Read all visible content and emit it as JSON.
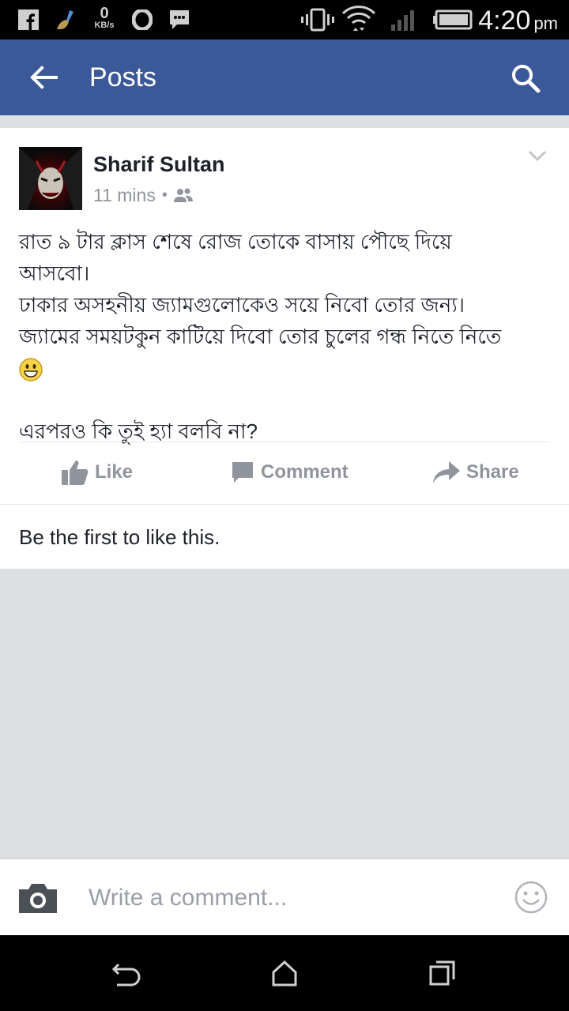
{
  "status_bar": {
    "net_speed_value": "0",
    "net_speed_unit": "KB/s",
    "time": "4:20",
    "ampm": "pm",
    "icons": [
      "facebook-icon",
      "broom-icon",
      "net-speed",
      "opera-icon",
      "messenger-icon",
      "vibrate-icon",
      "wifi-icon",
      "signal-icon",
      "battery-icon"
    ]
  },
  "app_bar": {
    "title": "Posts",
    "background": "#3b5998"
  },
  "post": {
    "author": "Sharif Sultan",
    "time": "11 mins",
    "audience_icon": "friends-icon",
    "lines": [
      "রাত ৯ টার ক্লাস শেষে রোজ তোকে বাসায় পৌছে দিয়ে",
      "আসবো।",
      "ঢাকার অসহনীয় জ্যামগুলোকেও সয়ে নিবো তোর জন্য।",
      "জ্যামের সময়টকুন  কাটিয়ে দিবো তোর  চুলের গন্ধ নিতে নিতে"
    ],
    "emoji": "grinning-face",
    "question": "এরপরও কি তুই হ্যা বলবি না?",
    "actions": {
      "like": "Like",
      "comment": "Comment",
      "share": "Share"
    },
    "likes_text": "Be the first to like this."
  },
  "comment_bar": {
    "placeholder": "Write a comment..."
  },
  "colors": {
    "brand": "#3b5998",
    "muted": "#90949c",
    "text": "#1d2129",
    "feed_bg": "#dddfe3"
  }
}
